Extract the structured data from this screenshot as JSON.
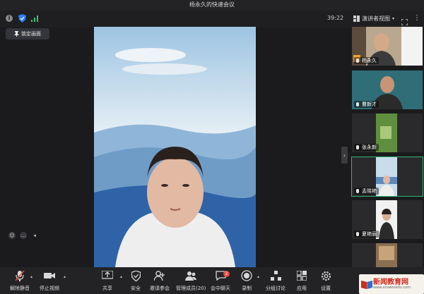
{
  "window": {
    "title": "杨永久的快速会议"
  },
  "topbar": {
    "timer": "39:22",
    "view_label": "演讲者视图",
    "more": "⋮"
  },
  "lock_button": {
    "label": "锁定画面"
  },
  "participants": [
    {
      "name": "杨永久"
    },
    {
      "name": "曹新才"
    },
    {
      "name": "张永新"
    },
    {
      "name": "孟晓艳"
    },
    {
      "name": "夏艳丽"
    },
    {
      "name": ""
    }
  ],
  "toolbar": {
    "unmute": "解除静音",
    "stop_video": "停止视频",
    "share": "共享",
    "security": "安全",
    "invite": "邀请参会",
    "members": "管理成员(20)",
    "chat": "会中聊天",
    "chat_badge": "2",
    "record": "录制",
    "breakout": "分组讨论",
    "apps": "应用",
    "settings": "设置"
  },
  "watermark": {
    "text": "新闻教育网",
    "url": "www.xinwenedu.com"
  },
  "colors": {
    "accent": "#2bb673",
    "badge": "#e84b3c",
    "shield": "#2a7ff5"
  }
}
